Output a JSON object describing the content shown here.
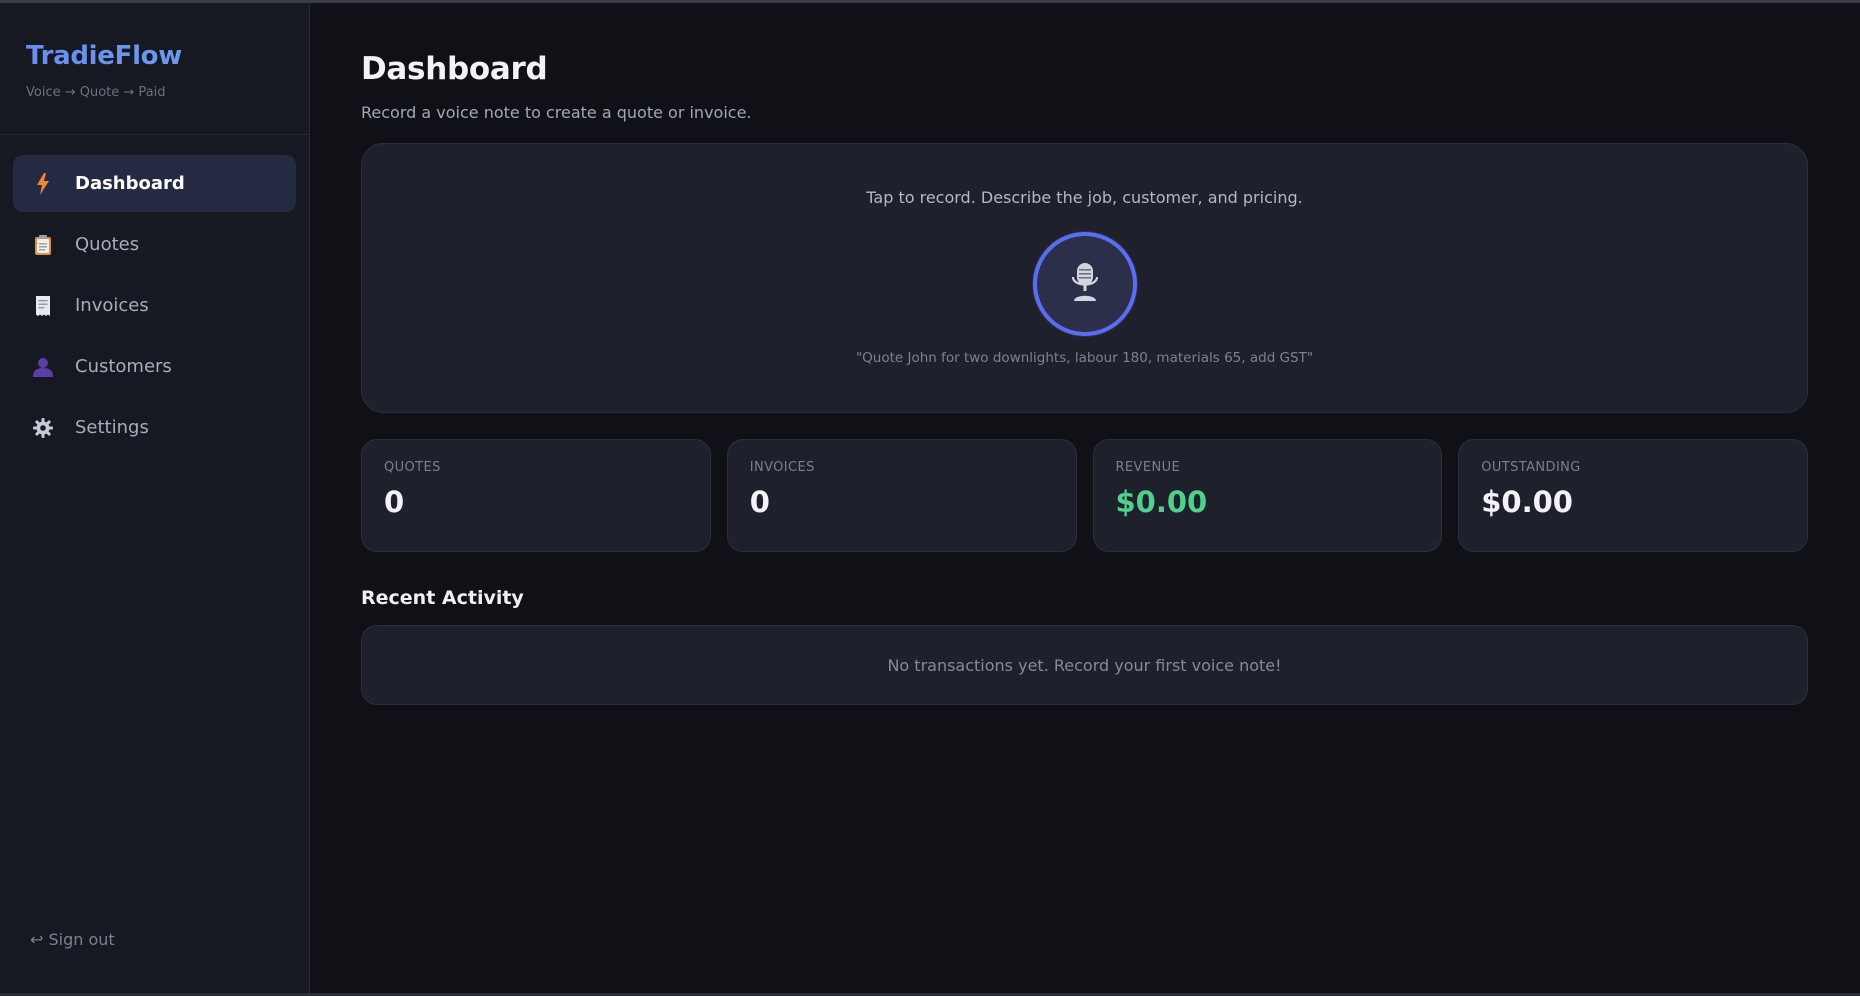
{
  "brand": {
    "name": "TradieFlow",
    "tagline": "Voice → Quote → Paid"
  },
  "sidebar": {
    "items": [
      {
        "label": "Dashboard",
        "icon": "lightning-icon",
        "active": true
      },
      {
        "label": "Quotes",
        "icon": "clipboard-icon",
        "active": false
      },
      {
        "label": "Invoices",
        "icon": "receipt-icon",
        "active": false
      },
      {
        "label": "Customers",
        "icon": "person-icon",
        "active": false
      },
      {
        "label": "Settings",
        "icon": "gear-icon",
        "active": false
      }
    ],
    "signout": "↩ Sign out"
  },
  "page": {
    "title": "Dashboard",
    "subtitle": "Record a voice note to create a quote or invoice."
  },
  "recorder": {
    "hint": "Tap to record. Describe the job, customer, and pricing.",
    "icon": "microphone-icon",
    "example": "\"Quote John for two downlights, labour 180, materials 65, add GST\""
  },
  "stats": [
    {
      "label": "QUOTES",
      "value": "0"
    },
    {
      "label": "INVOICES",
      "value": "0"
    },
    {
      "label": "REVENUE",
      "value": "$0.00"
    },
    {
      "label": "OUTSTANDING",
      "value": "$0.00"
    }
  ],
  "activity": {
    "title": "Recent Activity",
    "empty": "No transactions yet. Record your first voice note!"
  },
  "colors": {
    "accent": "#5b6df0",
    "revenue": "#4fd08c",
    "background": "#0f1116",
    "card": "#1e212c"
  }
}
